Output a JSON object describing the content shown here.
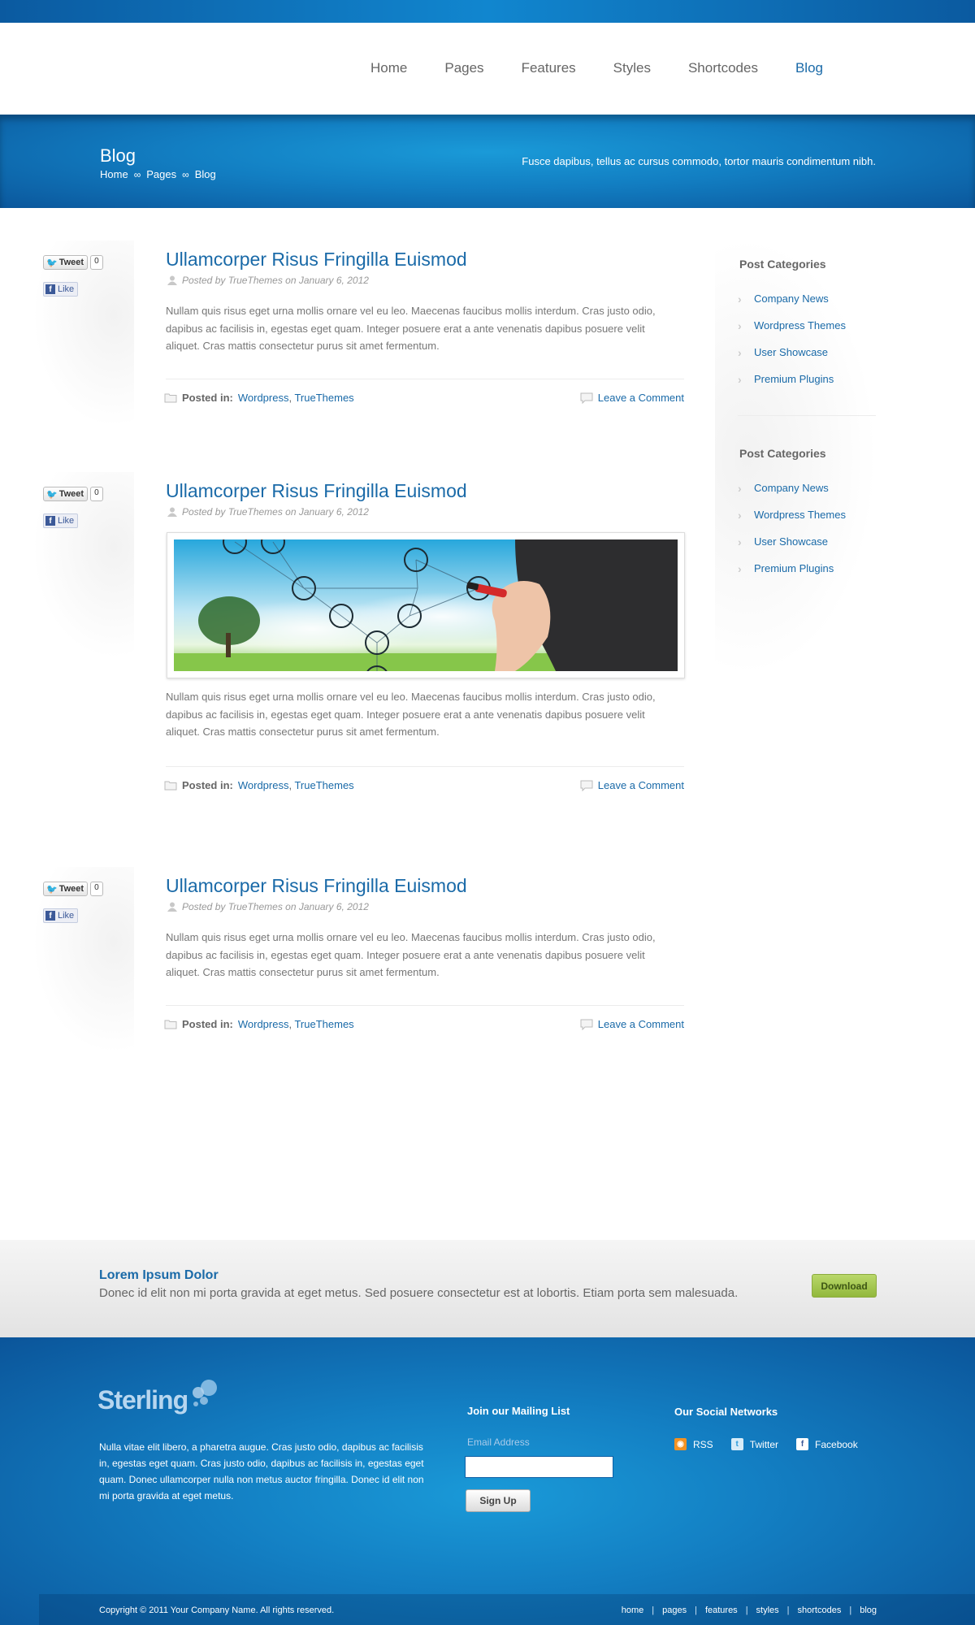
{
  "nav": {
    "items": [
      {
        "label": "Home"
      },
      {
        "label": "Pages"
      },
      {
        "label": "Features"
      },
      {
        "label": "Styles"
      },
      {
        "label": "Shortcodes"
      },
      {
        "label": "Blog",
        "active": true
      }
    ]
  },
  "banner": {
    "title": "Blog",
    "breadcrumb": [
      "Home",
      "Pages",
      "Blog"
    ],
    "breadcrumb_sep": "∞",
    "tagline": "Fusce dapibus, tellus ac cursus commodo, tortor mauris condimentum nibh."
  },
  "share": {
    "tweet_label": "Tweet",
    "tweet_count": "0",
    "like_label": "Like"
  },
  "posts": [
    {
      "title": "Ullamcorper Risus Fringilla Euismod",
      "meta": "Posted by TrueThemes on January 6, 2012",
      "body": "Nullam quis risus eget urna mollis ornare vel eu leo. Maecenas faucibus mollis interdum. Cras justo odio, dapibus ac facilisis in, egestas eget quam. Integer posuere erat a ante venenatis dapibus posuere velit aliquet. Cras mattis consectetur purus sit amet fermentum.",
      "posted_in_label": "Posted in:",
      "categories": [
        "Wordpress",
        "TrueThemes"
      ],
      "comment_label": "Leave a Comment"
    },
    {
      "title": "Ullamcorper Risus Fringilla Euismod",
      "meta": "Posted by TrueThemes on January 6, 2012",
      "body": "Nullam quis risus eget urna mollis ornare vel eu leo. Maecenas faucibus mollis interdum. Cras justo odio, dapibus ac facilisis in, egestas eget quam. Integer posuere erat a ante venenatis dapibus posuere velit aliquet. Cras mattis consectetur purus sit amet fermentum.",
      "posted_in_label": "Posted in:",
      "categories": [
        "Wordpress",
        "TrueThemes"
      ],
      "comment_label": "Leave a Comment"
    },
    {
      "title": "Ullamcorper Risus Fringilla Euismod",
      "meta": "Posted by TrueThemes on January 6, 2012",
      "body": "Nullam quis risus eget urna mollis ornare vel eu leo. Maecenas faucibus mollis interdum. Cras justo odio, dapibus ac facilisis in, egestas eget quam. Integer posuere erat a ante venenatis dapibus posuere velit aliquet. Cras mattis consectetur purus sit amet fermentum.",
      "posted_in_label": "Posted in:",
      "categories": [
        "Wordpress",
        "TrueThemes"
      ],
      "comment_label": "Leave a Comment"
    }
  ],
  "sidebar": {
    "widgets": [
      {
        "title": "Post Categories",
        "items": [
          "Company News",
          "Wordpress Themes",
          "User Showcase",
          "Premium Plugins"
        ]
      },
      {
        "title": "Post Categories",
        "items": [
          "Company News",
          "Wordpress Themes",
          "User Showcase",
          "Premium Plugins"
        ]
      }
    ]
  },
  "cta": {
    "title": "Lorem Ipsum Dolor",
    "text": "Donec id elit non mi porta gravida at eget metus. Sed posuere consectetur est at lobortis. Etiam porta sem malesuada.",
    "button": "Download"
  },
  "footer": {
    "logo_text": "Sterling",
    "about": "Nulla vitae elit libero, a pharetra augue. Cras justo odio, dapibus ac facilisis in, egestas eget quam. Cras justo odio, dapibus ac facilisis in, egestas eget quam. Donec ullamcorper nulla non metus auctor fringilla. Donec id elit non mi porta gravida at eget metus.",
    "mailing_title": "Join our Mailing List",
    "email_label": "Email Address",
    "signup_button": "Sign Up",
    "social_title": "Our Social Networks",
    "social": [
      {
        "label": "RSS",
        "icon": "rss-icon"
      },
      {
        "label": "Twitter",
        "icon": "twitter-icon"
      },
      {
        "label": "Facebook",
        "icon": "facebook-icon"
      }
    ],
    "copyright": "Copyright © 2011 Your Company Name. All rights reserved.",
    "nav": [
      "home",
      "pages",
      "features",
      "styles",
      "shortcodes",
      "blog"
    ]
  },
  "colors": {
    "accent": "#1a6aa8",
    "banner": "#127ec2",
    "download_green": "#92b83c"
  }
}
